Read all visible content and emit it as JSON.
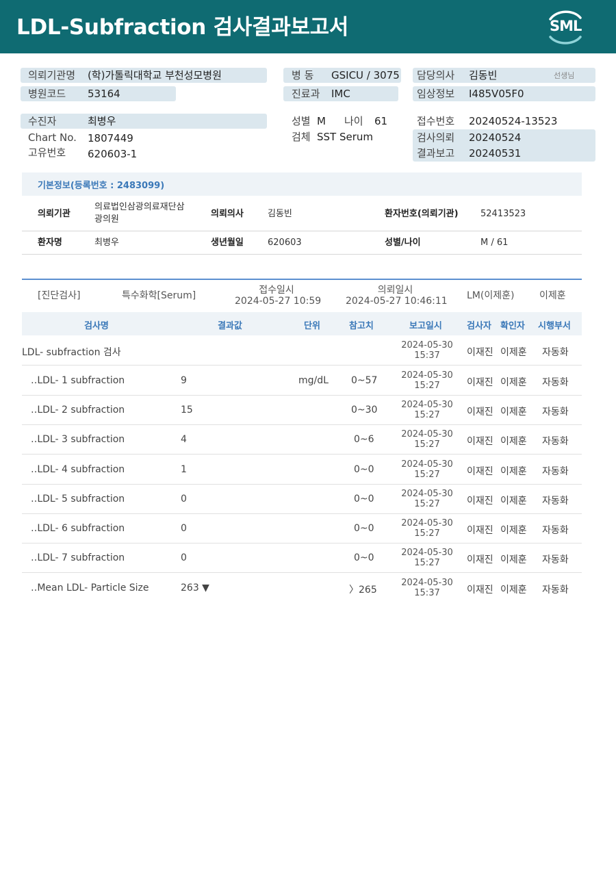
{
  "header": {
    "title": "LDL-Subfraction 검사결과보고서",
    "logo": "SML",
    "bg_color": "#0f6b72"
  },
  "patient": {
    "hospital_label": "의뢰기관명",
    "hospital_value": "(학)가톨릭대학교 부천성모병원",
    "hospital_code_label": "병원코드",
    "hospital_code_value": "53164",
    "patient_label": "수진자",
    "patient_value": "최병우",
    "chart_label": "Chart No.",
    "chart_value": "1807449",
    "unique_label": "고유번호",
    "unique_value": "620603-1",
    "ward_label": "병 동",
    "ward_value": "GSICU / 3075",
    "dept_label": "진료과",
    "dept_value": "IMC",
    "sex_label": "성별",
    "sex_value": "M",
    "age_label": "나이",
    "age_value": "61",
    "specimen_label": "검체",
    "specimen_value": "SST Serum",
    "doctor_label": "담당의사",
    "doctor_value": "김동빈",
    "doctor_suffix": "선생님",
    "clinical_label": "임상정보",
    "clinical_value": "I485V05F0",
    "receipt_label": "접수번호",
    "receipt_value": "20240524-13523",
    "request_label": "검사의뢰",
    "request_value": "20240524",
    "report_label": "결과보고",
    "report_value": "20240531"
  },
  "basic_info": {
    "title": "기본정보(등록번호 : 2483099)",
    "inst_label": "의뢰기관",
    "inst_value_1": "의료법인삼광의료재단삼",
    "inst_value_2": "광의원",
    "doctor_label": "의뢰의사",
    "doctor_value": "김동빈",
    "pat_no_label": "환자번호(의뢰기관)",
    "pat_no_value": "52413523",
    "name_label": "환자명",
    "name_value": "최병우",
    "birth_label": "생년월일",
    "birth_value": "620603",
    "sexage_label": "성별/나이",
    "sexage_value": "M / 61"
  },
  "summary": {
    "category": "[진단검사]",
    "section": "특수화학[Serum]",
    "received_label": "접수일시",
    "received_value": "2024-05-27 10:59",
    "requested_label": "의뢰일시",
    "requested_value": "2024-05-27 10:46:11",
    "lm": "LM(이제훈)",
    "confirmer": "이제훈"
  },
  "table": {
    "headers": [
      "검사명",
      "결과값",
      "단위",
      "참고치",
      "보고일시",
      "검사자",
      "확인자",
      "시행부서"
    ],
    "rows": [
      {
        "name": "LDL- subfraction 검사",
        "result": "",
        "unit": "",
        "ref": "",
        "date": "2024-05-30",
        "time": "15:37",
        "tester": "이재진",
        "checker": "이제훈",
        "dept": "자동화"
      },
      {
        "name": "‥LDL- 1 subfraction",
        "result": "9",
        "unit": "mg/dL",
        "ref": "0~57",
        "date": "2024-05-30",
        "time": "15:27",
        "tester": "이재진",
        "checker": "이제훈",
        "dept": "자동화"
      },
      {
        "name": "‥LDL- 2 subfraction",
        "result": "15",
        "unit": "",
        "ref": "0~30",
        "date": "2024-05-30",
        "time": "15:27",
        "tester": "이재진",
        "checker": "이제훈",
        "dept": "자동화"
      },
      {
        "name": "‥LDL- 3 subfraction",
        "result": "4",
        "unit": "",
        "ref": "0~6",
        "date": "2024-05-30",
        "time": "15:27",
        "tester": "이재진",
        "checker": "이제훈",
        "dept": "자동화"
      },
      {
        "name": "‥LDL- 4 subfraction",
        "result": "1",
        "unit": "",
        "ref": "0~0",
        "date": "2024-05-30",
        "time": "15:27",
        "tester": "이재진",
        "checker": "이제훈",
        "dept": "자동화"
      },
      {
        "name": "‥LDL- 5 subfraction",
        "result": "0",
        "unit": "",
        "ref": "0~0",
        "date": "2024-05-30",
        "time": "15:27",
        "tester": "이재진",
        "checker": "이제훈",
        "dept": "자동화"
      },
      {
        "name": "‥LDL- 6 subfraction",
        "result": "0",
        "unit": "",
        "ref": "0~0",
        "date": "2024-05-30",
        "time": "15:27",
        "tester": "이재진",
        "checker": "이제훈",
        "dept": "자동화"
      },
      {
        "name": "‥LDL- 7 subfraction",
        "result": "0",
        "unit": "",
        "ref": "0~0",
        "date": "2024-05-30",
        "time": "15:27",
        "tester": "이재진",
        "checker": "이제훈",
        "dept": "자동화"
      },
      {
        "name": "‥Mean LDL- Particle Size",
        "result": "263 ▼",
        "unit": "",
        "ref": "〉265",
        "date": "2024-05-30",
        "time": "15:37",
        "tester": "이재진",
        "checker": "이제훈",
        "dept": "자동화"
      }
    ]
  }
}
